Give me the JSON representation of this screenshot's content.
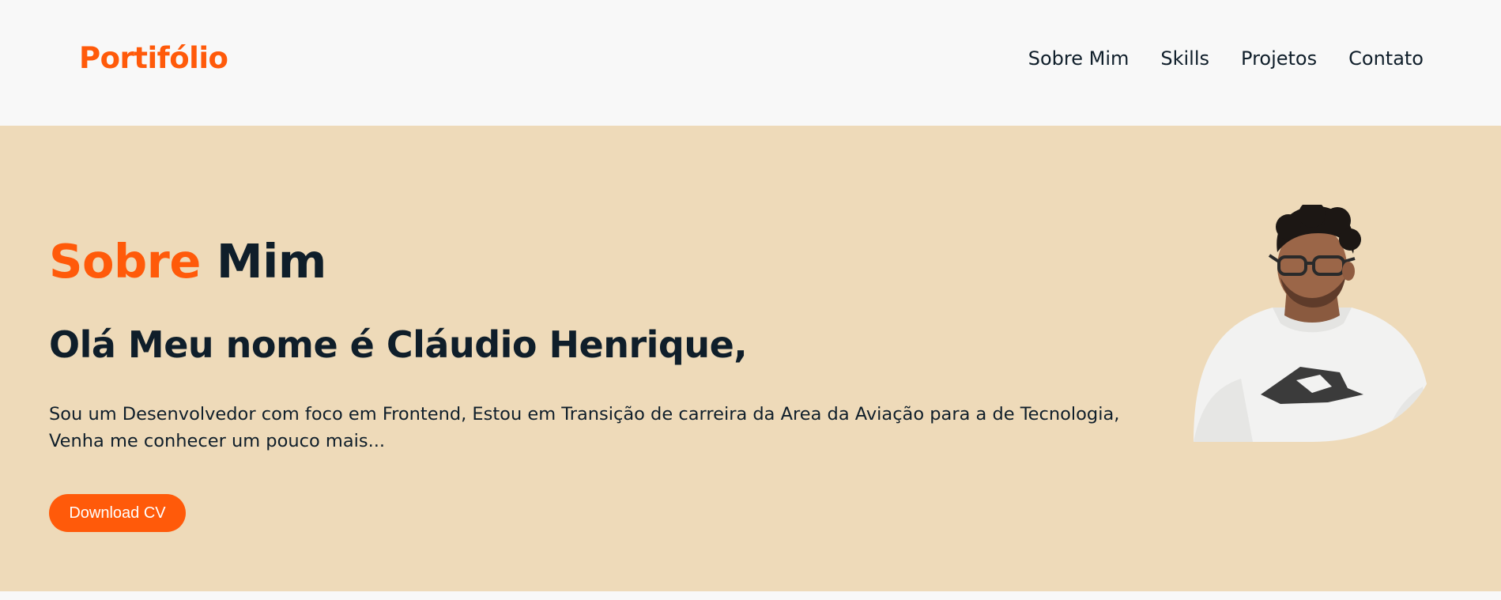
{
  "header": {
    "logo": "Portifólio",
    "nav": [
      "Sobre Mim",
      "Skills",
      "Projetos",
      "Contato"
    ]
  },
  "hero": {
    "title_accent": "Sobre",
    "title_rest": "Mim",
    "greeting": "Olá Meu nome é Cláudio Henrique,",
    "intro_line1": "Sou um Desenvolvedor com foco em Frontend, Estou em Transição de carreira da Area da Aviação para a de Tecnologia,",
    "intro_line2": "Venha me conhecer um pouco mais...",
    "cv_button": "Download CV"
  },
  "colors": {
    "accent": "#ff5a0a",
    "text_dark": "#0f1e2a",
    "hero_bg": "#eedab9",
    "header_bg": "#f8f8f8"
  }
}
